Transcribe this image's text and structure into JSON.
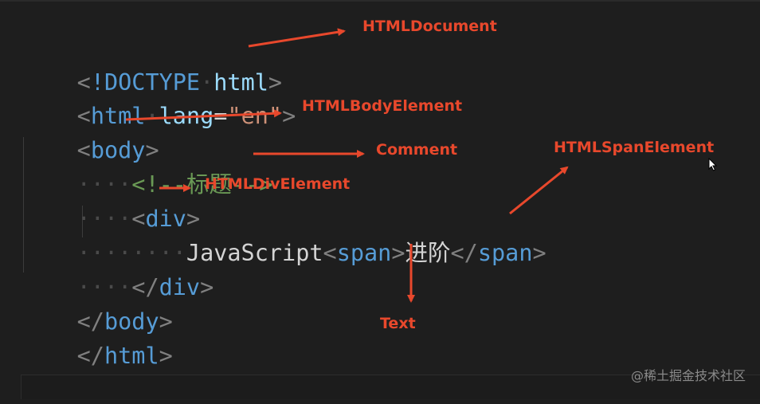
{
  "code": {
    "l1": {
      "open": "<",
      "bang": "!DOCTYPE",
      "sp": "·",
      "kw": "html",
      "close": ">"
    },
    "l2": {
      "open": "<",
      "tag": "html",
      "sp": "·",
      "attr": "lang",
      "eq": "=",
      "val": "\"en\"",
      "close": ">"
    },
    "l3": {
      "open": "<",
      "tag": "body",
      "close": ">"
    },
    "l4": {
      "dots": "····",
      "comment": "<!--标题-->"
    },
    "l5": {
      "dots": "····",
      "open": "<",
      "tag": "div",
      "close": ">"
    },
    "l6": {
      "dots": "········",
      "text": "JavaScript",
      "span_open": "<",
      "span_tag": "span",
      "span_close": ">",
      "inner": "进阶",
      "end_open": "</",
      "end_tag": "span",
      "end_close": ">"
    },
    "l7": {
      "dots": "····",
      "open": "</",
      "tag": "div",
      "close": ">"
    },
    "l8": {
      "open": "</",
      "tag": "body",
      "close": ">"
    },
    "l9": {
      "open": "</",
      "tag": "html",
      "close": ">"
    }
  },
  "annotations": {
    "document": "HTMLDocument",
    "body": "HTMLBodyElement",
    "comment": "Comment",
    "div": "HTMLDivElement",
    "span": "HTMLSpanElement",
    "text": "Text"
  },
  "watermark": "@稀土掘金技术社区",
  "colors": {
    "annotation": "#e8482c",
    "tag": "#569cd6",
    "comment": "#6a9955",
    "string": "#ce9178",
    "text": "#d4d4d4"
  }
}
